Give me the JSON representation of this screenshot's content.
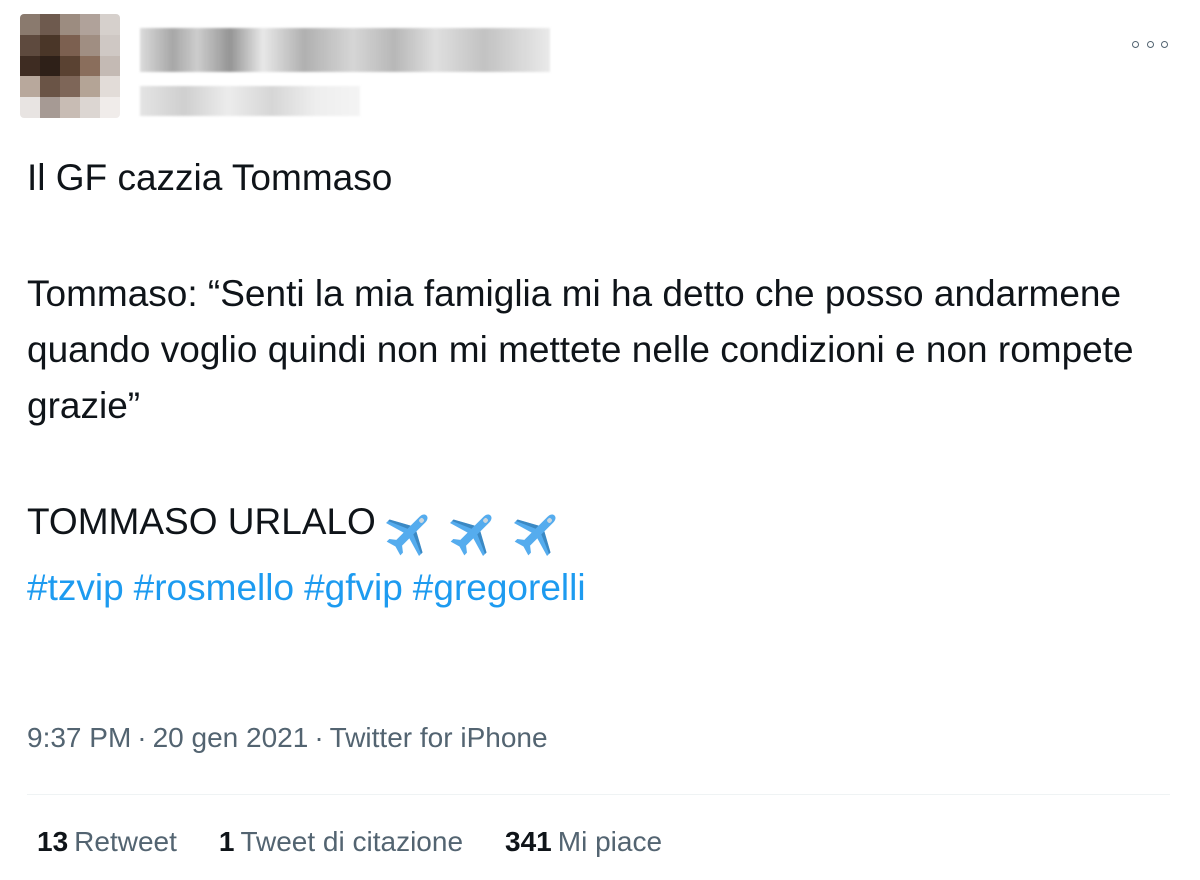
{
  "header": {
    "avatar_colors": [
      "#8a7a6e",
      "#6e5a4e",
      "#9c8c80",
      "#b0a29a",
      "#d6d0cc",
      "#5e4a3e",
      "#4a3628",
      "#7c6050",
      "#a08e82",
      "#cfc8c4",
      "#3e2c22",
      "#2e2018",
      "#5a4232",
      "#8a6e5c",
      "#c4bab4",
      "#b8a89c",
      "#6a5446",
      "#7e6658",
      "#b4a496",
      "#e2dcd8",
      "#e8e4e2",
      "#a69a94",
      "#c8bcb4",
      "#dcd6d2",
      "#f0ecea"
    ],
    "more_icon": "more-options-icon"
  },
  "tweet": {
    "line1": "Il GF cazzia Tommaso",
    "line2": "Tommaso: “Senti la mia famiglia mi ha detto che posso andarmene quando voglio quindi non mi mettete nelle condizioni e non rompete grazie”",
    "line3": "TOMMASO URLALO",
    "emoji": "airplane-emoji",
    "hashtags": [
      "#tzvip",
      "#rosmello",
      "#gfvip",
      "#gregorelli"
    ]
  },
  "meta": {
    "time": "9:37 PM",
    "date": "20 gen 2021",
    "source": "Twitter for iPhone",
    "separator": "·"
  },
  "stats": {
    "retweets_count": "13",
    "retweets_label": "Retweet",
    "quotes_count": "1",
    "quotes_label": "Tweet di citazione",
    "likes_count": "341",
    "likes_label": "Mi piace"
  },
  "colors": {
    "link": "#1d9bf0",
    "secondary_text": "#536471",
    "primary_text": "#0f1419",
    "divider": "#eff3f4"
  }
}
